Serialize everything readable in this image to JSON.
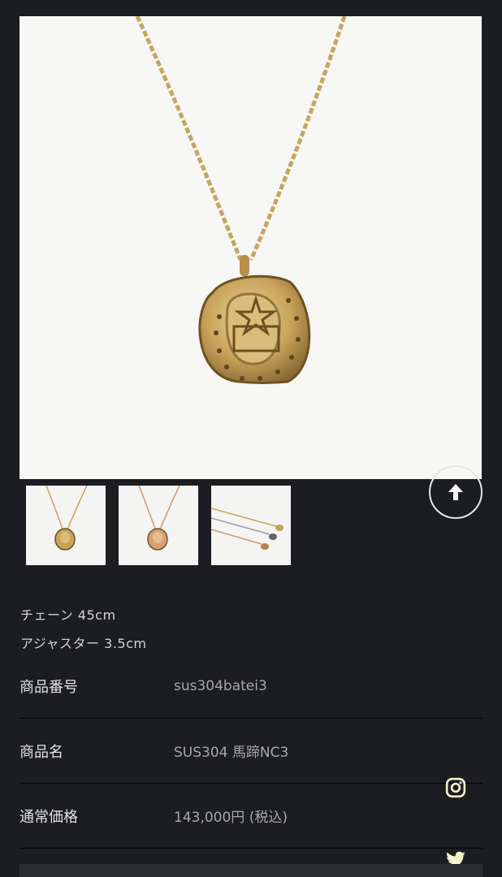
{
  "product": {
    "main_image": "horseshoe-pendant-necklace-photo",
    "thumbnails": [
      {
        "image": "horseshoe-pendant-thumbnail"
      },
      {
        "image": "horseshoe-pendant-rose-thumbnail"
      },
      {
        "image": "chain-variations-thumbnail"
      }
    ],
    "description_lines": [
      "チェーン 45cm",
      "アジャスター 3.5cm"
    ],
    "specs": [
      {
        "label": "商品番号",
        "value": "sus304batei3"
      },
      {
        "label": "商品名",
        "value": "SUS304 馬蹄NC3"
      },
      {
        "label": "通常価格",
        "value": "143,000円 (税込)"
      }
    ]
  },
  "controls": {
    "scroll_top_icon": "arrow-up-icon",
    "instagram_icon": "instagram-icon",
    "twitter_icon": "twitter-icon"
  },
  "colors": {
    "background": "#1c1d21",
    "gold": "#c9a35a",
    "photo_bg": "#f7f7f5"
  }
}
